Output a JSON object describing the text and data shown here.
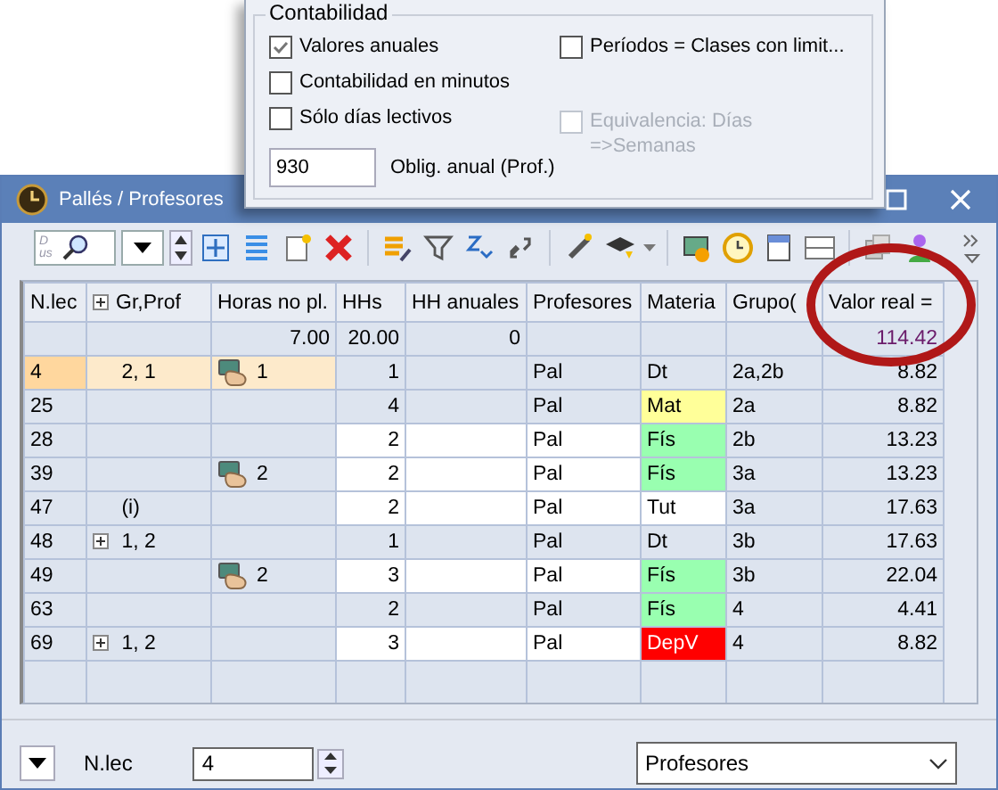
{
  "window": {
    "title": "Pallés / Profesores"
  },
  "popup": {
    "group_title": "Contabilidad",
    "left_options": [
      {
        "label": "Valores anuales",
        "checked": true,
        "disabled": false
      },
      {
        "label": "Contabilidad en minutos",
        "checked": false,
        "disabled": false
      },
      {
        "label": "Sólo días lectivos",
        "checked": false,
        "disabled": false
      }
    ],
    "right_options": [
      {
        "label": "Períodos = Clases con limit...",
        "checked": false,
        "disabled": false
      },
      {
        "label": "Equivalencia: Días =>Semanas",
        "checked": false,
        "disabled": true
      }
    ],
    "field": {
      "value": "930",
      "label": "Oblig. anual (Prof.)"
    }
  },
  "toolbar": {
    "lookup_field_value": "D us"
  },
  "table": {
    "columns": [
      "N.lec",
      "Gr,Prof",
      "Horas no pl.",
      "HHs",
      "HH anuales",
      "Profesores",
      "Materia",
      "Grupo(",
      "Valor real ="
    ],
    "totals": {
      "horas": "7.00",
      "hhs": "20.00",
      "hh_anuales": "0",
      "valor": "114.42"
    },
    "rows": [
      {
        "nlec": "4",
        "gr_prof": "2, 1",
        "expandable": false,
        "horas": "1",
        "hhs": "1",
        "profesores": "Pal",
        "materia": {
          "text": "Dt"
        },
        "grupo": "2a,2b",
        "valor": "8.82",
        "selected": true,
        "editable": false
      },
      {
        "nlec": "25",
        "expandable": false,
        "hhs": "4",
        "profesores": "Pal",
        "materia": {
          "text": "Mat",
          "color": "#ffff99"
        },
        "grupo": "2a",
        "valor": "8.82",
        "selected": false,
        "editable": false
      },
      {
        "nlec": "28",
        "expandable": false,
        "hhs": "2",
        "profesores": "Pal",
        "materia": {
          "text": "Fís",
          "color": "#99ffb0"
        },
        "grupo": "2b",
        "valor": "13.23",
        "selected": false,
        "editable": true
      },
      {
        "nlec": "39",
        "expandable": false,
        "horas": "2",
        "hhs": "2",
        "profesores": "Pal",
        "materia": {
          "text": "Fís",
          "color": "#99ffb0"
        },
        "grupo": "3a",
        "valor": "13.23",
        "selected": false,
        "editable": true
      },
      {
        "nlec": "47",
        "gr_prof": "(i)",
        "expandable": false,
        "hhs": "2",
        "profesores": "Pal",
        "materia": {
          "text": "Tut",
          "color": "#ffffff"
        },
        "grupo": "3a",
        "valor": "17.63",
        "selected": false,
        "editable": true
      },
      {
        "nlec": "48",
        "gr_prof": "1, 2",
        "expandable": true,
        "hhs": "1",
        "profesores": "Pal",
        "materia": {
          "text": "Dt"
        },
        "grupo": "3b",
        "valor": "17.63",
        "selected": false,
        "editable": false
      },
      {
        "nlec": "49",
        "expandable": false,
        "horas": "2",
        "hhs": "3",
        "profesores": "Pal",
        "materia": {
          "text": "Fís",
          "color": "#99ffb0"
        },
        "grupo": "3b",
        "valor": "22.04",
        "selected": false,
        "editable": true
      },
      {
        "nlec": "63",
        "expandable": false,
        "hhs": "2",
        "profesores": "Pal",
        "materia": {
          "text": "Fís",
          "color": "#99ffb0"
        },
        "grupo": "4",
        "valor": "4.41",
        "selected": false,
        "editable": false
      },
      {
        "nlec": "69",
        "gr_prof": "1, 2",
        "expandable": true,
        "hhs": "3",
        "profesores": "Pal",
        "materia": {
          "text": "DepV",
          "color": "#ff0000"
        },
        "grupo": "4",
        "valor": "8.82",
        "selected": false,
        "editable": true
      }
    ]
  },
  "bottom_bar": {
    "label": "N.lec",
    "spin_value": "4",
    "combo_value": "Profesores"
  }
}
